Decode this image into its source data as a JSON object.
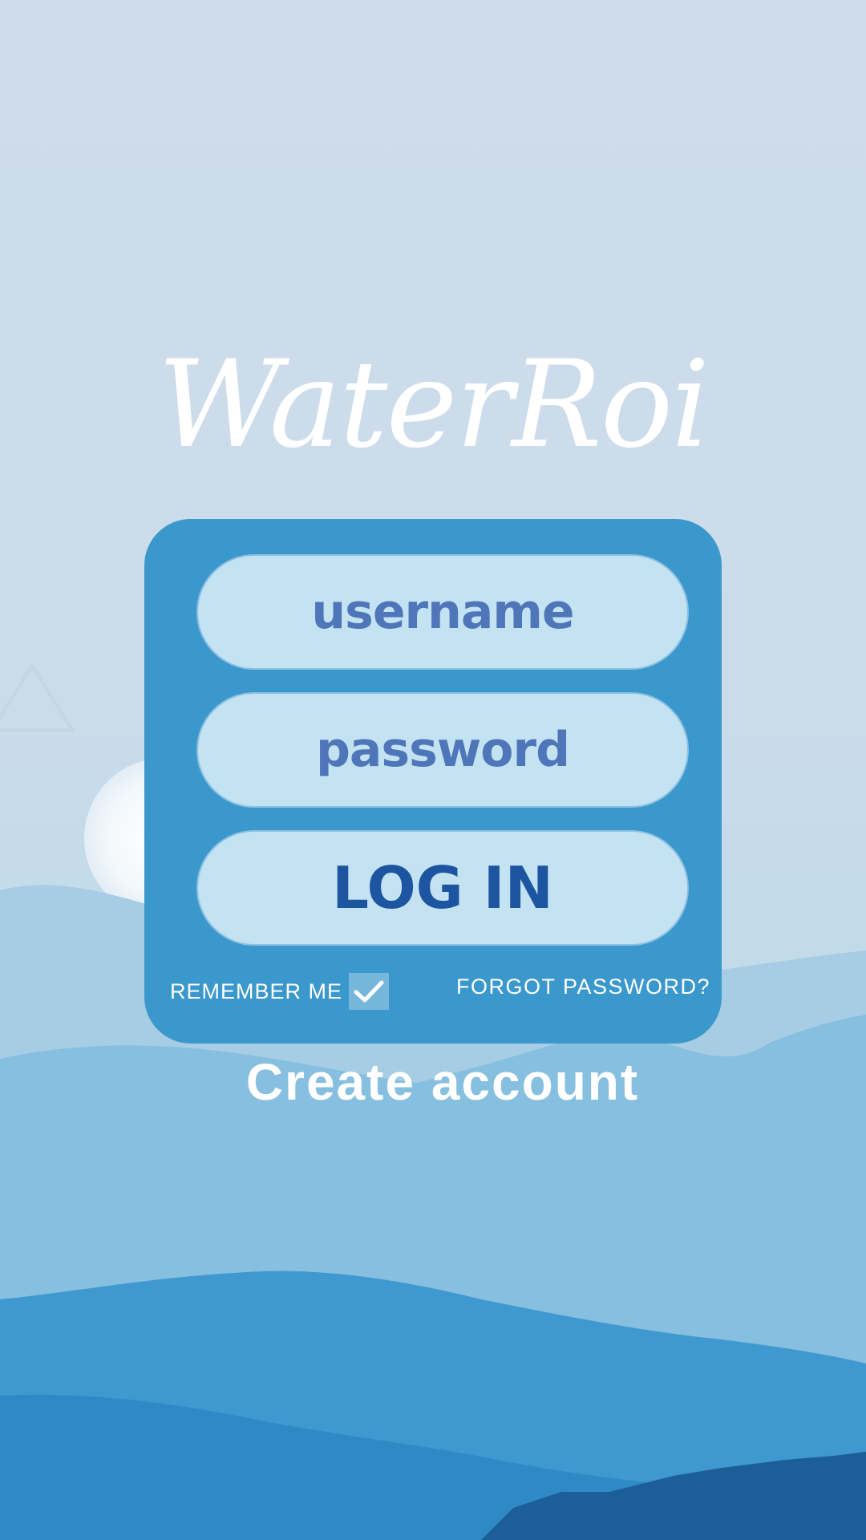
{
  "app": {
    "logo_text": "WaterRoi"
  },
  "form": {
    "username_placeholder": "username",
    "password_placeholder": "password",
    "login_label": "LOG IN",
    "remember_label": "REMEMBER ME",
    "remember_checked": true,
    "forgot_label": "FORGOT PASSWORD?"
  },
  "footer": {
    "create_account_label": "Create account"
  },
  "colors": {
    "sky": "#ccdcea",
    "panel": "#3b98cc",
    "field": "#c3e2f2",
    "field_text": "#4f76b8",
    "login_text": "#1e55a0",
    "text_light": "#ffffff"
  },
  "icons": {
    "checkbox": "check-icon",
    "background": "mountain-landscape"
  }
}
